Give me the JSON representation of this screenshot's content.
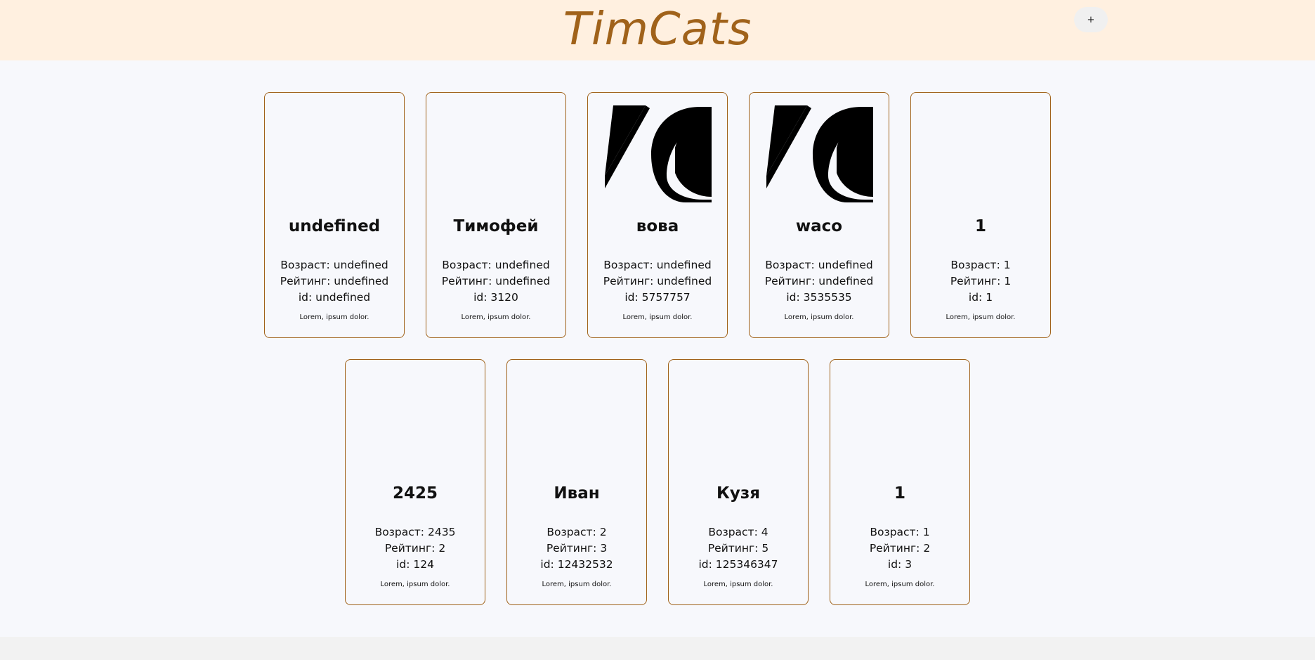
{
  "header": {
    "title": "TimCats",
    "add_label": "+"
  },
  "labels": {
    "age": "Возраст:",
    "rating": "Рейтинг:",
    "id": "id:"
  },
  "cats": [
    {
      "name": "undefined",
      "age": "undefined",
      "rating": "undefined",
      "id": "undefined",
      "description": "Lorem, ipsum dolor.",
      "has_image": false
    },
    {
      "name": "Тимофей",
      "age": "undefined",
      "rating": "undefined",
      "id": "3120",
      "description": "Lorem, ipsum dolor.",
      "has_image": false
    },
    {
      "name": "вова",
      "age": "undefined",
      "rating": "undefined",
      "id": "5757757",
      "description": "Lorem, ipsum dolor.",
      "has_image": true
    },
    {
      "name": "waco",
      "age": "undefined",
      "rating": "undefined",
      "id": "3535535",
      "description": "Lorem, ipsum dolor.",
      "has_image": true
    },
    {
      "name": "1",
      "age": "1",
      "rating": "1",
      "id": "1",
      "description": "Lorem, ipsum dolor.",
      "has_image": false
    },
    {
      "name": "2425",
      "age": "2435",
      "rating": "2",
      "id": "124",
      "description": "Lorem, ipsum dolor.",
      "has_image": false
    },
    {
      "name": "Иван",
      "age": "2",
      "rating": "3",
      "id": "12432532",
      "description": "Lorem, ipsum dolor.",
      "has_image": false
    },
    {
      "name": "Кузя",
      "age": "4",
      "rating": "5",
      "id": "125346347",
      "description": "Lorem, ipsum dolor.",
      "has_image": false
    },
    {
      "name": "1",
      "age": "1",
      "rating": "2",
      "id": "3",
      "description": "Lorem, ipsum dolor.",
      "has_image": false
    }
  ]
}
